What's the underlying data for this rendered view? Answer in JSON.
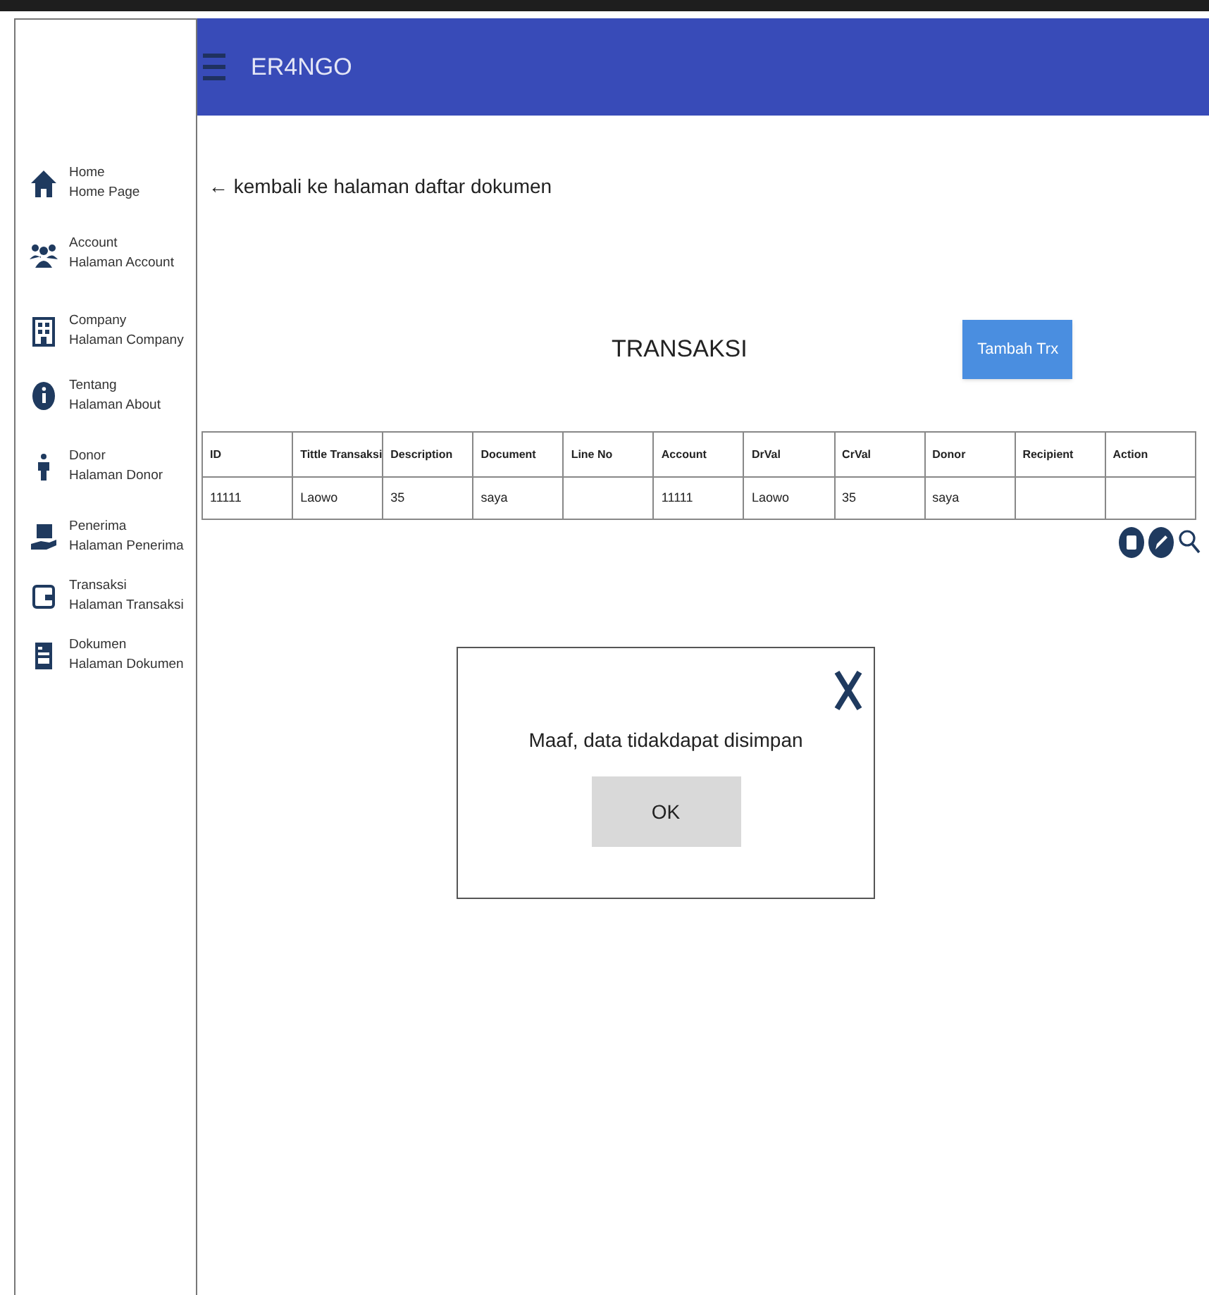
{
  "header": {
    "title": "ER4NGO"
  },
  "sidebar": {
    "items": [
      {
        "title": "Home",
        "subtitle": "Home Page"
      },
      {
        "title": "Account",
        "subtitle": "Halaman Account"
      },
      {
        "title": "Company",
        "subtitle": "Halaman Company"
      },
      {
        "title": "Tentang",
        "subtitle": "Halaman About"
      },
      {
        "title": "Donor",
        "subtitle": "Halaman Donor"
      },
      {
        "title": "Penerima",
        "subtitle": "Halaman Penerima"
      },
      {
        "title": "Transaksi",
        "subtitle": "Halaman Transaksi"
      },
      {
        "title": "Dokumen",
        "subtitle": "Halaman Dokumen"
      }
    ]
  },
  "back_link": "← kembali ke halaman daftar dokumen",
  "page_title": "TRANSAKSI",
  "add_button": "Tambah Trx",
  "table": {
    "columns": [
      "ID",
      "Tittle Transaksi",
      "Description",
      "Document",
      "Line No",
      "Account",
      "DrVal",
      "CrVal",
      "Donor",
      "Recipient",
      "Action"
    ],
    "rows": [
      [
        "11111",
        "Laowo",
        "35",
        "saya",
        "",
        "11111",
        "Laowo",
        "35",
        "saya",
        "",
        ""
      ]
    ]
  },
  "dialog": {
    "message": "Maaf, data tidakdapat disimpan",
    "button": "OK"
  }
}
